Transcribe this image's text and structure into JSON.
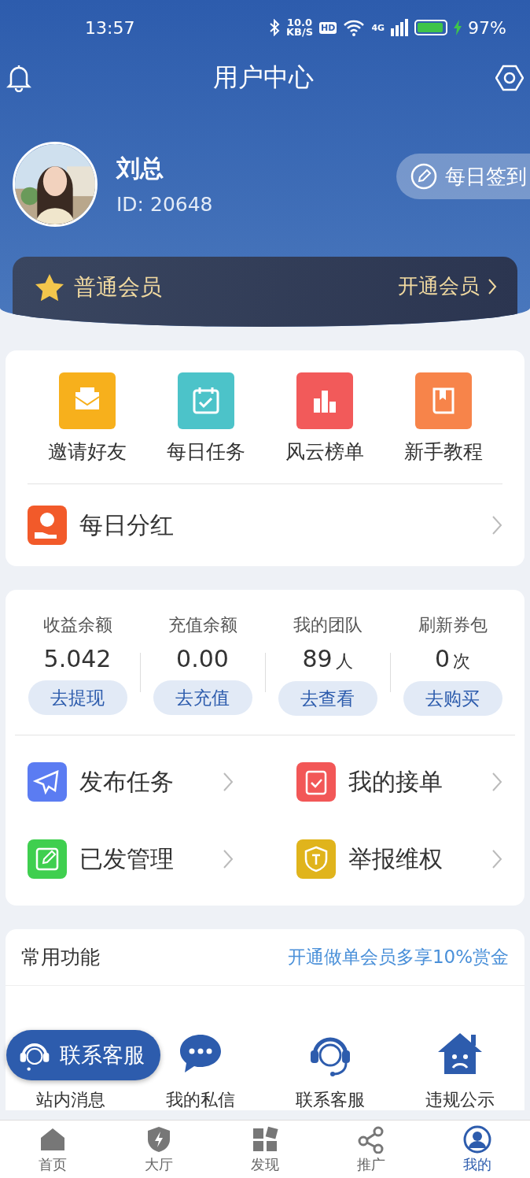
{
  "status_bar": {
    "time": "13:57",
    "network_speed": "10.0",
    "speed_unit": "KB/S",
    "hd": "HD",
    "network": "4G",
    "battery": "97%"
  },
  "nav": {
    "title": "用户中心"
  },
  "profile": {
    "name": "刘总",
    "id": "ID: 20648",
    "checkin_button": "每日签到"
  },
  "membership": {
    "level": "普通会员",
    "action": "开通会员"
  },
  "quick_actions": [
    {
      "label": "邀请好友",
      "kind": "invite",
      "color": "#f7b01c"
    },
    {
      "label": "每日任务",
      "kind": "task",
      "color": "#4cc3c9"
    },
    {
      "label": "风云榜单",
      "kind": "rank",
      "color": "#f25a5a"
    },
    {
      "label": "新手教程",
      "kind": "guide",
      "color": "#f7844a"
    }
  ],
  "dividend_row": {
    "label": "每日分红"
  },
  "balances": [
    {
      "label": "收益余额",
      "value": "5.042",
      "action": "去提现"
    },
    {
      "label": "充值余额",
      "value": "0.00",
      "action": "去充值"
    },
    {
      "label": "我的团队",
      "value": "89",
      "unit": "人",
      "action": "去查看"
    },
    {
      "label": "刷新券包",
      "value": "0",
      "unit": "次",
      "action": "去购买"
    }
  ],
  "task_links": [
    {
      "label": "发布任务",
      "kind": "publish",
      "color": "#5b7cf2"
    },
    {
      "label": "我的接单",
      "kind": "orders",
      "color": "#f25757"
    },
    {
      "label": "已发管理",
      "kind": "manage",
      "color": "#3fcf4f"
    },
    {
      "label": "举报维权",
      "kind": "report",
      "color": "#e0b41c"
    }
  ],
  "common_functions": {
    "title": "常用功能",
    "promo": "开通做单会员多享10%赏金",
    "items": [
      {
        "label": "站内消息"
      },
      {
        "label": "我的私信",
        "kind": "chat"
      },
      {
        "label": "联系客服",
        "kind": "support"
      },
      {
        "label": "违规公示",
        "kind": "violation"
      }
    ]
  },
  "floating_button": {
    "label": "联系客服"
  },
  "tab_bar": [
    {
      "label": "首页",
      "kind": "home",
      "selected": false
    },
    {
      "label": "大厅",
      "kind": "hall",
      "selected": false
    },
    {
      "label": "发现",
      "kind": "discover",
      "selected": false
    },
    {
      "label": "推广",
      "kind": "share",
      "selected": false
    },
    {
      "label": "我的",
      "kind": "me",
      "selected": true
    }
  ]
}
